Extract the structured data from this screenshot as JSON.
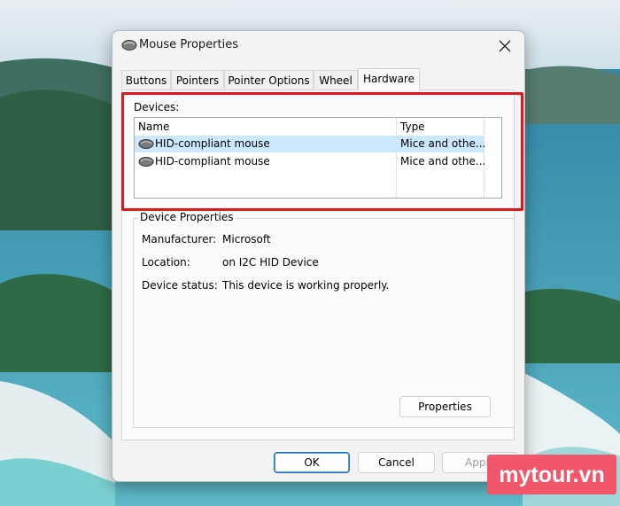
{
  "window": {
    "title": "Mouse Properties",
    "close_icon": "close-icon"
  },
  "tabs": [
    {
      "label": "Buttons",
      "active": false
    },
    {
      "label": "Pointers",
      "active": false
    },
    {
      "label": "Pointer Options",
      "active": false
    },
    {
      "label": "Wheel",
      "active": false
    },
    {
      "label": "Hardware",
      "active": true
    }
  ],
  "devices": {
    "label": "Devices:",
    "columns": [
      "Name",
      "Type"
    ],
    "rows": [
      {
        "name": "HID-compliant mouse",
        "type": "Mice and othe...",
        "selected": true,
        "icon": "mouse-icon"
      },
      {
        "name": "HID-compliant mouse",
        "type": "Mice and othe...",
        "selected": false,
        "icon": "mouse-icon"
      }
    ]
  },
  "device_properties": {
    "title": "Device Properties",
    "manufacturer_label": "Manufacturer:",
    "manufacturer_value": "Microsoft",
    "location_label": "Location:",
    "location_value": "on I2C HID Device",
    "status_label": "Device status:",
    "status_value": "This device is working properly.",
    "properties_button": "Properties"
  },
  "footer": {
    "ok": "OK",
    "cancel": "Cancel",
    "apply": "Apply"
  },
  "watermark": {
    "text": "mytour.vn"
  },
  "colors": {
    "highlight": "#e0161b",
    "selected_row": "#cce8ff",
    "watermark_bg": "#f1566a",
    "primary_button_border": "#1f6fc1"
  }
}
